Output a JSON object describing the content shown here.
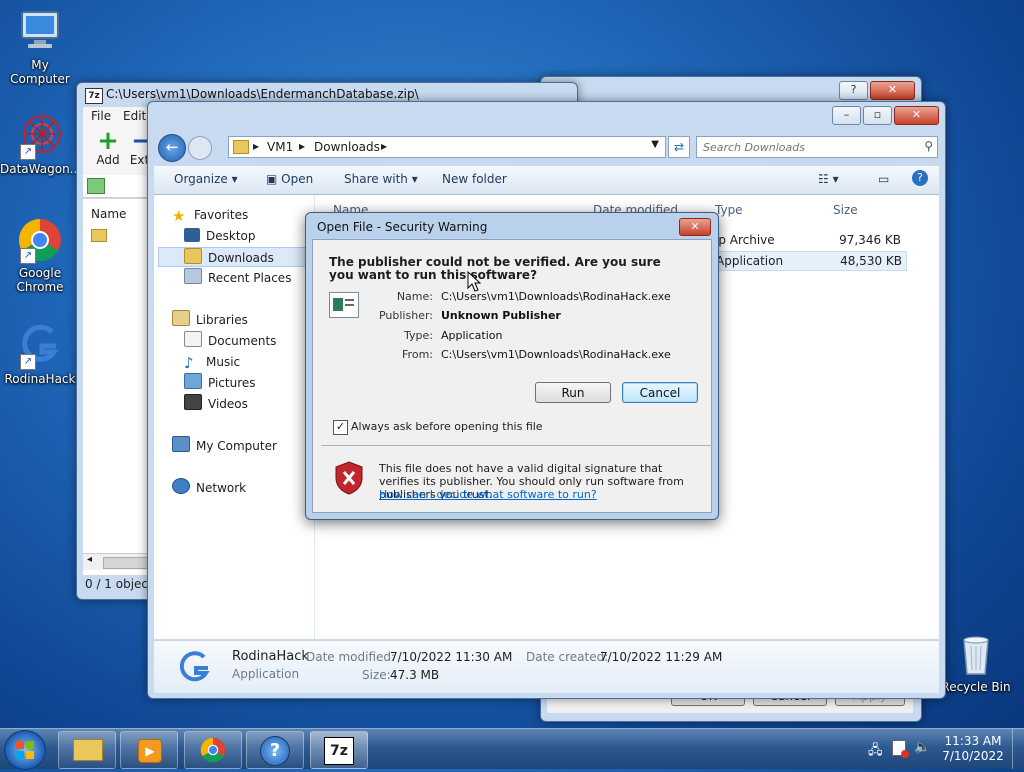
{
  "desktop": {
    "icons": [
      {
        "label": "My Computer"
      },
      {
        "label": "DataWagon..."
      },
      {
        "label": "Google Chrome"
      },
      {
        "label": "RodinaHack"
      },
      {
        "label": "Recycle Bin"
      }
    ]
  },
  "sevenzip": {
    "title": "C:\\Users\\vm1\\Downloads\\EndermanchDatabase.zip\\",
    "menu": [
      "File",
      "Edit"
    ],
    "add_label": "Add",
    "extract_label": "Extr",
    "col_name": "Name",
    "status": "0 / 1 object("
  },
  "explorer": {
    "breadcrumb": [
      "VM1",
      "Downloads"
    ],
    "search_placeholder": "Search Downloads",
    "toolbar": {
      "organize": "Organize",
      "open": "Open",
      "share_with": "Share with",
      "new_folder": "New folder"
    },
    "nav": {
      "favorites": "Favorites",
      "desktop": "Desktop",
      "downloads": "Downloads",
      "recent_places": "Recent Places",
      "libraries": "Libraries",
      "documents": "Documents",
      "music": "Music",
      "pictures": "Pictures",
      "videos": "Videos",
      "my_computer": "My Computer",
      "network": "Network"
    },
    "columns": {
      "name": "Name",
      "date_modified": "Date modified",
      "type": "Type",
      "size": "Size"
    },
    "rows": [
      {
        "type": "ip Archive",
        "size": "97,346 KB"
      },
      {
        "type": "Application",
        "size": "48,530 KB"
      }
    ],
    "details": {
      "name": "RodinaHack",
      "kind": "Application",
      "date_modified_label": "Date modified:",
      "date_modified": "7/10/2022 11:30 AM",
      "size_label": "Size:",
      "size": "47.3 MB",
      "date_created_label": "Date created:",
      "date_created": "7/10/2022 11:29 AM"
    }
  },
  "back_dialog": {
    "ok": "OK",
    "cancel": "Cancel",
    "apply": "Apply"
  },
  "security_dialog": {
    "title": "Open File - Security Warning",
    "heading": "The publisher could not be verified.  Are you sure you want to run this software?",
    "fields": [
      {
        "label": "Name:",
        "value": "C:\\Users\\vm1\\Downloads\\RodinaHack.exe",
        "bold": false
      },
      {
        "label": "Publisher:",
        "value": "Unknown Publisher",
        "bold": true
      },
      {
        "label": "Type:",
        "value": "Application",
        "bold": false
      },
      {
        "label": "From:",
        "value": "C:\\Users\\vm1\\Downloads\\RodinaHack.exe",
        "bold": false
      }
    ],
    "run_label": "Run",
    "cancel_label": "Cancel",
    "checkbox_label": "Always ask before opening this file",
    "checkbox_checked": true,
    "warning_text": "This file does not have a valid digital signature that verifies its publisher.  You should only run software from publishers you trust.",
    "link_text": "How can I decide what software to run?"
  },
  "taskbar": {
    "time": "11:33 AM",
    "date": "7/10/2022",
    "apps": [
      "explorer-icon",
      "media-player-icon",
      "chrome-icon",
      "help-icon",
      "sevenzip-icon"
    ]
  },
  "colors": {
    "accent": "#1f66b8",
    "link": "#0066cc",
    "warning_red": "#c0262c"
  }
}
